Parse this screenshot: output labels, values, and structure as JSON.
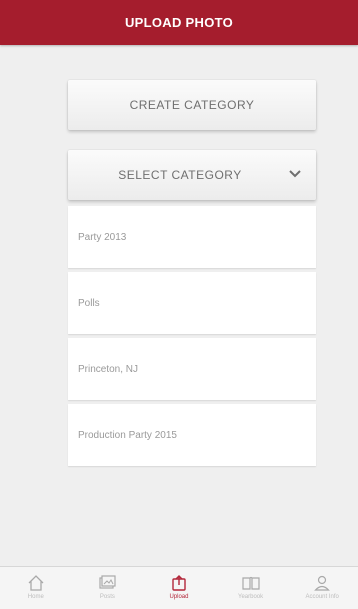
{
  "header": {
    "title": "UPLOAD PHOTO"
  },
  "actions": {
    "create_label": "CREATE CATEGORY",
    "select_label": "SELECT CATEGORY"
  },
  "categories": [
    {
      "label": "Party 2013"
    },
    {
      "label": "Polls"
    },
    {
      "label": "Princeton, NJ"
    },
    {
      "label": "Production Party 2015"
    }
  ],
  "tabbar": {
    "items": [
      {
        "label": "Home",
        "icon": "home-icon"
      },
      {
        "label": "Posts",
        "icon": "photos-icon"
      },
      {
        "label": "Upload",
        "icon": "upload-icon"
      },
      {
        "label": "Yearbook",
        "icon": "book-icon"
      },
      {
        "label": "Account Info",
        "icon": "user-icon"
      }
    ]
  },
  "colors": {
    "brand": "#a51d2d",
    "active_tab": "#b3273a"
  }
}
